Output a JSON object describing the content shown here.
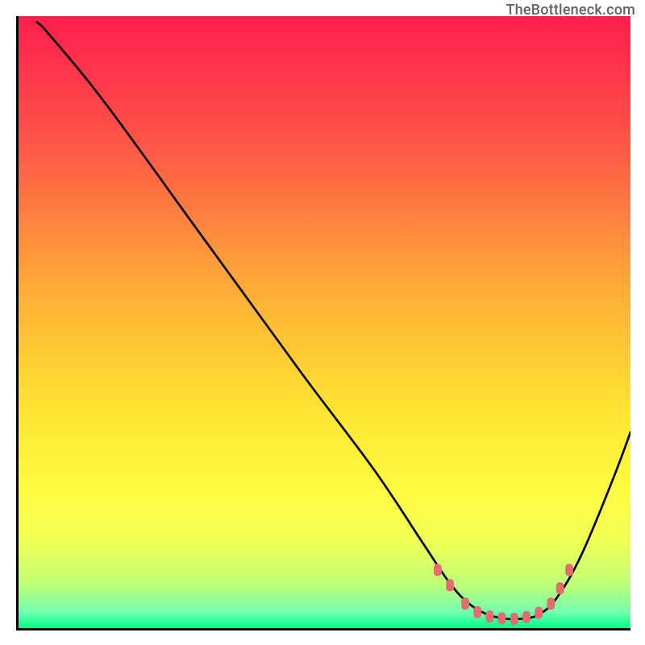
{
  "watermark": "TheBottleneck.com",
  "chart_data": {
    "type": "line",
    "title": "",
    "xlabel": "",
    "ylabel": "",
    "xlim": [
      0,
      100
    ],
    "ylim": [
      0,
      100
    ],
    "gradient_stops": [
      {
        "offset": 0,
        "color": "#ff1e4e"
      },
      {
        "offset": 0.2,
        "color": "#ff5348"
      },
      {
        "offset": 0.46,
        "color": "#ffb137"
      },
      {
        "offset": 0.64,
        "color": "#ffe431"
      },
      {
        "offset": 0.77,
        "color": "#fffb40"
      },
      {
        "offset": 0.86,
        "color": "#f0ff55"
      },
      {
        "offset": 0.93,
        "color": "#bdff78"
      },
      {
        "offset": 0.975,
        "color": "#6fffb0"
      },
      {
        "offset": 1.0,
        "color": "#00ff88"
      }
    ],
    "series": [
      {
        "name": "bottleneck-curve",
        "x": [
          3,
          5,
          14,
          30,
          46,
          58,
          66,
          70,
          73,
          76,
          79,
          82,
          85,
          88,
          92,
          97,
          100
        ],
        "y": [
          99,
          97,
          86,
          64,
          42,
          26,
          14,
          8,
          4.5,
          2.5,
          1.6,
          1.5,
          2.2,
          5,
          12,
          24,
          32
        ]
      }
    ],
    "markers": {
      "series": "bottleneck-curve",
      "color": "#e26d6d",
      "points": [
        {
          "x": 68.5,
          "y": 9.5
        },
        {
          "x": 70.5,
          "y": 7.0
        },
        {
          "x": 73,
          "y": 4.0
        },
        {
          "x": 75,
          "y": 2.6
        },
        {
          "x": 77,
          "y": 1.9
        },
        {
          "x": 79,
          "y": 1.6
        },
        {
          "x": 81,
          "y": 1.5
        },
        {
          "x": 83,
          "y": 1.8
        },
        {
          "x": 85,
          "y": 2.5
        },
        {
          "x": 87,
          "y": 4.0
        },
        {
          "x": 88.5,
          "y": 6.5
        },
        {
          "x": 90,
          "y": 9.5
        }
      ]
    }
  }
}
